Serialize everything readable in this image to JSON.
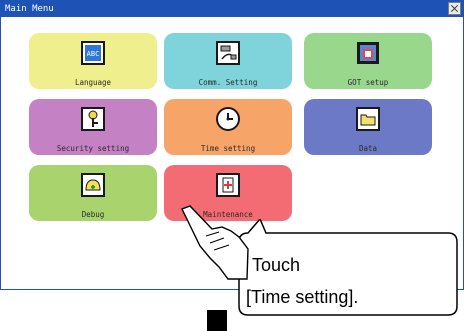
{
  "window": {
    "title": "Main Menu"
  },
  "tiles": [
    {
      "label": "Language",
      "icon": "language-icon",
      "color": "#f0ef8d"
    },
    {
      "label": "Comm. Setting",
      "icon": "comm-setting-icon",
      "color": "#7fd4db"
    },
    {
      "label": "GOT setup",
      "icon": "got-setup-icon",
      "color": "#98d78c"
    },
    {
      "label": "Security setting",
      "icon": "key-icon",
      "color": "#c481c4"
    },
    {
      "label": "Time setting",
      "icon": "clock-icon",
      "color": "#f7a468"
    },
    {
      "label": "Data",
      "icon": "folder-icon",
      "color": "#6b79c7"
    },
    {
      "label": "Debug",
      "icon": "debug-icon",
      "color": "#a9d36d"
    },
    {
      "label": "Maintenance",
      "icon": "maintenance-icon",
      "color": "#f36b73"
    }
  ],
  "callout": {
    "line1": "Touch",
    "line2": "[Time setting]."
  }
}
